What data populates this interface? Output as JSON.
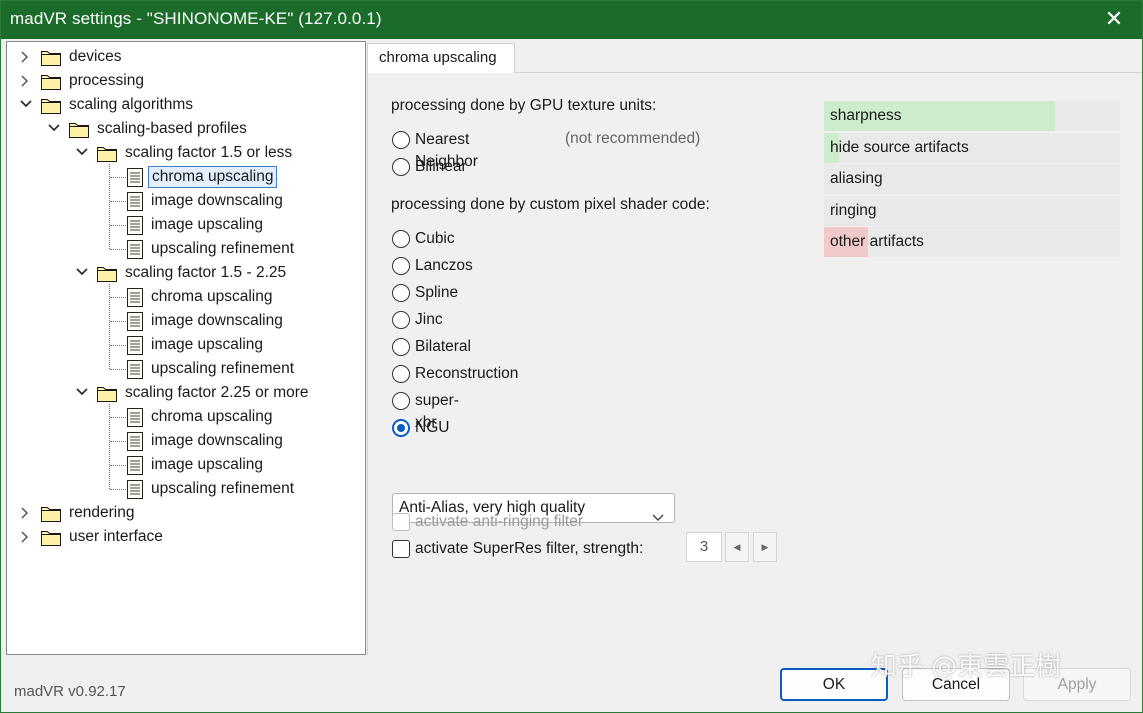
{
  "window": {
    "title": "madVR settings - \"SHINONOME-KE\" (127.0.0.1)",
    "close_glyph": "✕"
  },
  "tree": {
    "devices": "devices",
    "processing": "processing",
    "scaling_algorithms": "scaling algorithms",
    "scaling_profiles": "scaling-based profiles",
    "groups": [
      {
        "label": "scaling factor 1.5 or less",
        "items": [
          "chroma upscaling",
          "image downscaling",
          "image upscaling",
          "upscaling refinement"
        ]
      },
      {
        "label": "scaling factor 1.5 - 2.25",
        "items": [
          "chroma upscaling",
          "image downscaling",
          "image upscaling",
          "upscaling refinement"
        ]
      },
      {
        "label": "scaling factor 2.25 or more",
        "items": [
          "chroma upscaling",
          "image downscaling",
          "image upscaling",
          "upscaling refinement"
        ]
      }
    ],
    "rendering": "rendering",
    "user_interface": "user interface",
    "selected": "chroma upscaling"
  },
  "tab": {
    "label": "chroma upscaling"
  },
  "gpu_section": {
    "heading": "processing done by GPU texture units:",
    "options": [
      "Nearest Neighbor",
      "Bilinear"
    ],
    "note": "(not recommended)"
  },
  "shader_section": {
    "heading": "processing done by custom pixel shader code:",
    "options": [
      "Cubic",
      "Lanczos",
      "Spline",
      "Jinc",
      "Bilateral",
      "Reconstruction",
      "super-xbr",
      "NGU"
    ],
    "selected": "NGU"
  },
  "quality_select": {
    "value": "Anti-Alias, very high quality"
  },
  "checkboxes": {
    "anti_ringing": "activate anti-ringing filter",
    "superres": "activate SuperRes filter, strength:"
  },
  "superres_strength": {
    "value": "3",
    "left_arrow": "◀",
    "right_arrow": "▶"
  },
  "quality_bars": [
    {
      "label": "sharpness",
      "level": 0.78,
      "color": "#cdeccc"
    },
    {
      "label": "hide source artifacts",
      "level": 0.05,
      "color": "#cdeccc"
    },
    {
      "label": "aliasing",
      "level": 0,
      "color": "#cdeccc"
    },
    {
      "label": "ringing",
      "level": 0,
      "color": "#cdeccc"
    },
    {
      "label": "other artifacts",
      "level": 0.15,
      "color": "#f1c9cb"
    }
  ],
  "footer": {
    "version": "madVR v0.92.17",
    "ok": "OK",
    "cancel": "Cancel",
    "apply": "Apply"
  },
  "watermark": {
    "text": "知乎 @東雲正樹"
  },
  "colors": {
    "titlebar": "#1b6b2b",
    "accent": "#0a5cc2",
    "selection": "#3a7fd0"
  }
}
